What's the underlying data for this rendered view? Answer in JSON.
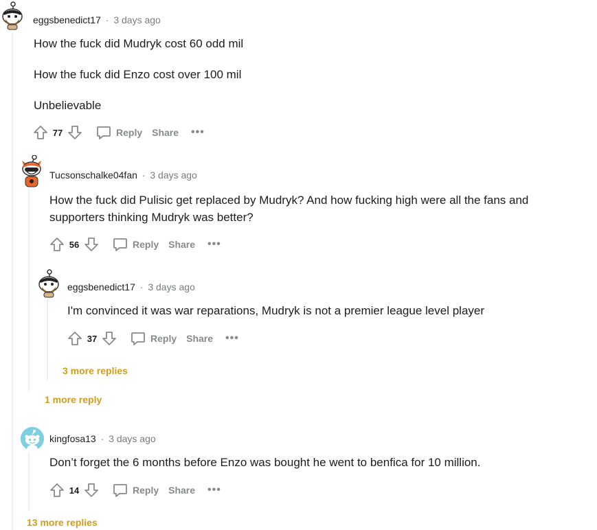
{
  "colors": {
    "more_replies": "#d29c1b",
    "action_text": "#878a8c",
    "thread_line": "#edeff1",
    "meta_time": "#787c7e"
  },
  "icons": {
    "upvote": "arrow-up-outline-icon",
    "downvote": "arrow-down-outline-icon",
    "reply": "speech-bubble-icon",
    "more": "ellipsis-icon"
  },
  "comments": [
    {
      "author": "eggsbenedict17",
      "separator": "·",
      "time": "3 days ago",
      "lines": [
        "How the fuck did Mudryk cost 60 odd mil",
        "How the fuck did Enzo cost over 100 mil",
        "Unbelievable"
      ],
      "score": "77",
      "reply_label": "Reply",
      "share_label": "Share",
      "more_label": "•••"
    },
    {
      "author": "Tucsonschalke04fan",
      "separator": "·",
      "time": "3 days ago",
      "lines": [
        "How the fuck did Pulisic get replaced by Mudryk? And how fucking high were all the fans and supporters thinking Mudryk was better?"
      ],
      "score": "56",
      "reply_label": "Reply",
      "share_label": "Share",
      "more_label": "•••"
    },
    {
      "author": "eggsbenedict17",
      "separator": "·",
      "time": "3 days ago",
      "lines": [
        "I'm convinced it was war reparations, Mudryk is not a premier league level player"
      ],
      "score": "37",
      "reply_label": "Reply",
      "share_label": "Share",
      "more_label": "•••"
    },
    {
      "author": "kingfosa13",
      "separator": "·",
      "time": "3 days ago",
      "lines": [
        "Don’t forget the 6 months before Enzo was bought he went to benfica for 10 million."
      ],
      "score": "14",
      "reply_label": "Reply",
      "share_label": "Share",
      "more_label": "•••"
    }
  ],
  "more_replies": {
    "level3": "3 more replies",
    "level2": "1 more reply",
    "level1": "13 more replies"
  }
}
